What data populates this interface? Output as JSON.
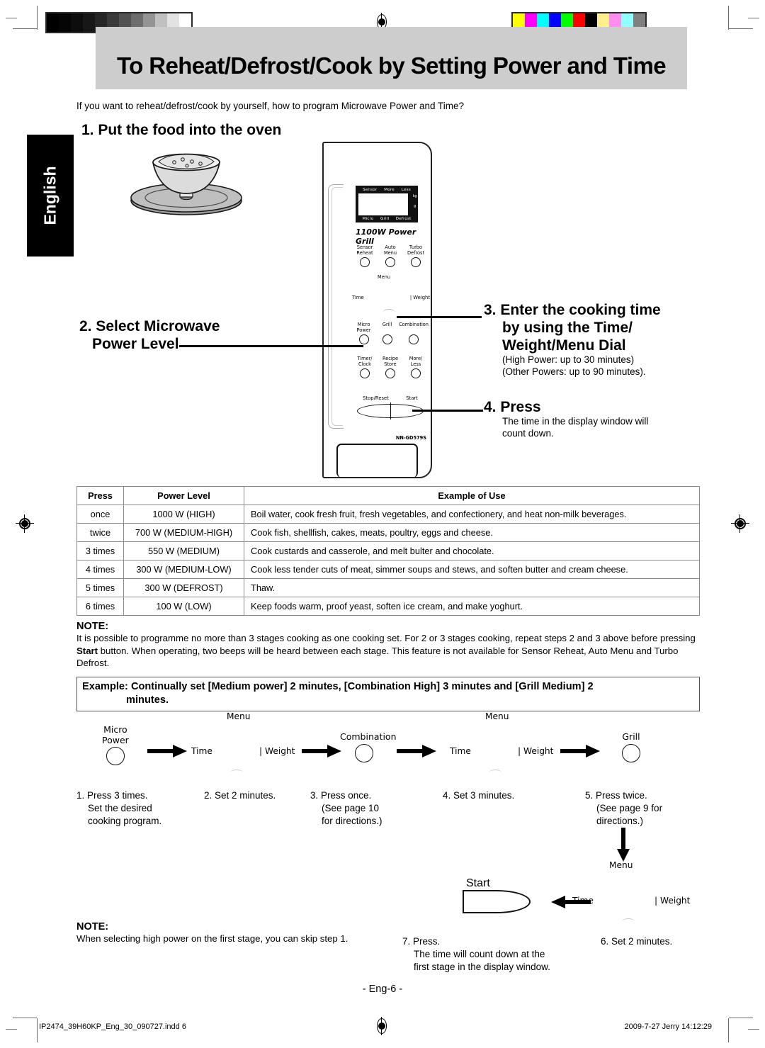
{
  "document": {
    "title": "To Reheat/Defrost/Cook by Setting Power and Time",
    "intro": "If you want to reheat/defrost/cook by yourself, how to program Microwave Power and Time?",
    "language_tab": "English",
    "page_number": "- Eng-6 -",
    "footer_file": "IP2474_39H60KP_Eng_30_090727.indd   6",
    "footer_stamp": "2009-7-27   Jerry 14:12:29"
  },
  "steps": {
    "step1": "1. Put the food into the oven",
    "step2_line1": "2. Select Microwave",
    "step2_line2": "Power Level",
    "step3_line1": "3. Enter the cooking time",
    "step3_line2": "by using the Time/",
    "step3_line3": "Weight/Menu Dial",
    "step3_note1": "(High Power: up to 30 minutes)",
    "step3_note2": "(Other Powers: up to 90 minutes).",
    "step4_head": "4. Press",
    "step4_note1": "The time in the display window will",
    "step4_note2": "count down."
  },
  "oven": {
    "model": "NN-GD579S",
    "brand_line": "1100W Power Grill",
    "lcd_top": [
      "Sensor",
      "More",
      "Less"
    ],
    "lcd_bottom": [
      "Micro",
      "Grill",
      "Defrost"
    ],
    "lcd_units": [
      "kg",
      "g"
    ],
    "dial_time": "Time",
    "dial_weight": "| Weight",
    "menu_label": "Menu",
    "row1": [
      {
        "line1": "Sensor",
        "line2": "Reheat"
      },
      {
        "line1": "Auto",
        "line2": "Menu"
      },
      {
        "line1": "Turbo",
        "line2": "Defrost"
      }
    ],
    "row2": [
      {
        "line1": "Micro",
        "line2": "Power"
      },
      {
        "line1": "Grill",
        "line2": ""
      },
      {
        "line1": "Combination",
        "line2": ""
      }
    ],
    "row3": [
      {
        "line1": "Timer/",
        "line2": "Clock"
      },
      {
        "line1": "Recipe",
        "line2": "Store"
      },
      {
        "line1": "More/",
        "line2": "Less"
      }
    ],
    "stop_label": "Stop/Reset",
    "start_label": "Start"
  },
  "power_table": {
    "headers": [
      "Press",
      "Power Level",
      "Example of Use"
    ],
    "rows": [
      {
        "press": "once",
        "level": "1000 W (HIGH)",
        "use": "Boil water, cook fresh fruit, fresh vegetables, and confectionery, and heat non-milk beverages."
      },
      {
        "press": "twice",
        "level": "700 W (MEDIUM-HIGH)",
        "use": "Cook fish, shellfish, cakes, meats, poultry, eggs and cheese."
      },
      {
        "press": "3 times",
        "level": "550 W (MEDIUM)",
        "use": "Cook custards and casserole, and melt bulter and chocolate."
      },
      {
        "press": "4 times",
        "level": "300 W (MEDIUM-LOW)",
        "use": "Cook less tender cuts of meat, simmer soups and stews, and soften butter and cream cheese."
      },
      {
        "press": "5 times",
        "level": "300 W (DEFROST)",
        "use": "Thaw."
      },
      {
        "press": "6 times",
        "level": "100 W (LOW)",
        "use": "Keep foods warm, proof yeast, soften ice cream, and make yoghurt."
      }
    ]
  },
  "note1": {
    "head": "NOTE:",
    "part1": "It is possible to programme no more than 3 stages cooking as one cooking set. For 2 or 3 stages cooking, repeat steps 2 and 3 above before pressing ",
    "bold": "Start",
    "part2": " button. When operating, two beeps will be heard between each stage. This feature is not available for Sensor Reheat, Auto Menu and Turbo Defrost."
  },
  "example_box": {
    "line1": "Example: Continually set [Medium power] 2 minutes, [Combination High] 3 minutes and [Grill Medium] 2",
    "line2": "minutes."
  },
  "flow": {
    "menu_label": "Menu",
    "time_label": "Time",
    "weight_label": "| Weight",
    "knob1": {
      "line1": "Micro",
      "line2": "Power"
    },
    "knob2": {
      "line1": "Combination",
      "line2": ""
    },
    "knob3": {
      "line1": "Grill",
      "line2": ""
    },
    "start_label": "Start",
    "cap1": "1. Press 3 times.\n    Set the desired\n    cooking program.",
    "cap1_l1": "1. Press 3 times.",
    "cap1_l2": "Set the desired",
    "cap1_l3": "cooking program.",
    "cap2": "2. Set 2 minutes.",
    "cap3_l1": "3. Press once.",
    "cap3_l2": "(See page 10",
    "cap3_l3": "for directions.)",
    "cap4": "4. Set 3 minutes.",
    "cap5_l1": "5. Press twice.",
    "cap5_l2": "(See page 9 for",
    "cap5_l3": "directions.)",
    "cap6": "6. Set 2 minutes.",
    "cap7_l1": "7. Press.",
    "cap7_l2": "The time will count down at the",
    "cap7_l3": "first stage in the display window."
  },
  "note2": {
    "head": "NOTE:",
    "body": "When selecting high power on the first stage, you can skip step 1."
  },
  "calibration": {
    "gray_steps": [
      "#000000",
      "#050505",
      "#0d0d0d",
      "#171717",
      "#262626",
      "#3a3a3a",
      "#525252",
      "#6e6e6e",
      "#949494",
      "#c0c0c0",
      "#e2e2e2",
      "#ffffff"
    ],
    "color_steps": [
      "#ffff00",
      "#ff00ff",
      "#00ffff",
      "#0000ff",
      "#00ff00",
      "#ff0000",
      "#000000",
      "#ffef8f",
      "#ff8fef",
      "#8fffff",
      "#808080"
    ]
  }
}
